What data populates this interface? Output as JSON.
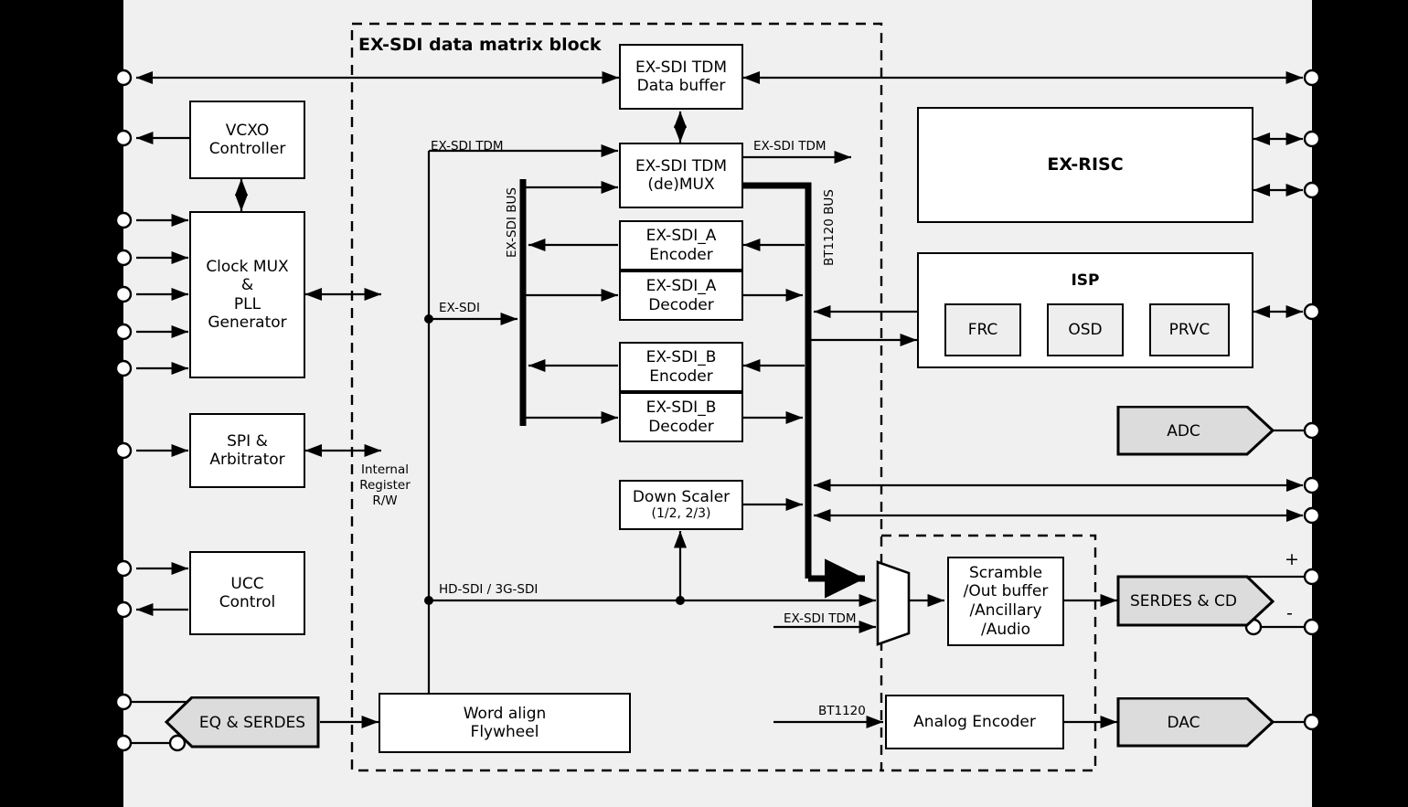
{
  "diagram": {
    "title": "EX-SDI data matrix block",
    "blocks": {
      "tdm_data_buffer": "EX-SDI TDM\nData buffer",
      "tdm_demux": "EX-SDI TDM\n(de)MUX",
      "exsdi_a_encoder": "EX-SDI_A\nEncoder",
      "exsdi_a_decoder": "EX-SDI_A\nDecoder",
      "exsdi_b_encoder": "EX-SDI_B\nEncoder",
      "exsdi_b_decoder": "EX-SDI_B\nDecoder",
      "down_scaler_main": "Down Scaler",
      "down_scaler_sub": "(1/2, 2/3)",
      "word_align": "Word align\nFlywheel",
      "vcxo_controller": "VCXO\nController",
      "clock_mux_pll": "Clock MUX\n&\nPLL\nGenerator",
      "spi_arbitrator": "SPI &\nArbitrator",
      "ucc_control": "UCC\nControl",
      "eq_serdes": "EQ & SERDES",
      "ex_risc": "EX-RISC",
      "isp": "ISP",
      "frc": "FRC",
      "osd": "OSD",
      "prvc": "PRVC",
      "adc": "ADC",
      "scramble": "Scramble\n/Out buffer\n/Ancillary\n/Audio",
      "serdes_cd": "SERDES & CD",
      "analog_encoder": "Analog Encoder",
      "dac": "DAC"
    },
    "signal_labels": {
      "exsdi_tdm_in": "EX-SDI TDM",
      "exsdi_tdm_out": "EX-SDI TDM",
      "exsdi_tdm_mux": "EX-SDI TDM",
      "exsdi": "EX-SDI",
      "exsdi_bus": "EX-SDI BUS",
      "bt1120_bus": "BT1120 BUS",
      "internal_register_rw": "Internal\nRegister\nR/W",
      "hd_sdi_3g_sdi": "HD-SDI / 3G-SDI",
      "bt1120": "BT1120",
      "plus": "+",
      "minus": "-"
    },
    "colors": {
      "canvas_bg": "#f0f0f0",
      "frame": "#000000",
      "block_fill": "#ffffff",
      "gray_fill": "#dcdcdc",
      "isp_sub_fill": "#eeeeee"
    }
  }
}
